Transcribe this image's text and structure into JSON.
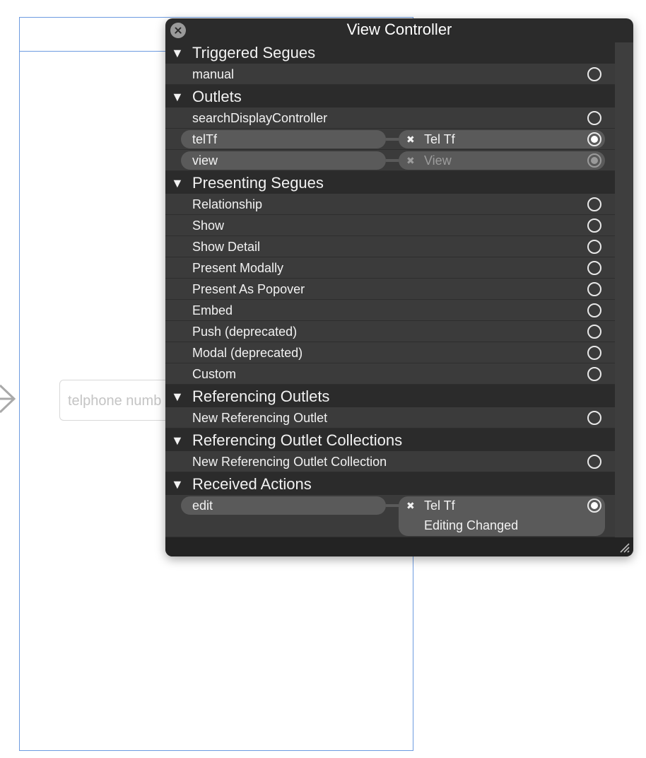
{
  "canvas": {
    "textfield_placeholder": "telphone numb"
  },
  "hud": {
    "title": "View Controller",
    "sections": {
      "triggered_segues": {
        "label": "Triggered Segues",
        "items": [
          {
            "label": "manual"
          }
        ]
      },
      "outlets": {
        "label": "Outlets",
        "items": [
          {
            "label": "searchDisplayController"
          },
          {
            "label": "telTf",
            "target": "Tel Tf"
          },
          {
            "label": "view",
            "target": "View"
          }
        ]
      },
      "presenting_segues": {
        "label": "Presenting Segues",
        "items": [
          {
            "label": "Relationship"
          },
          {
            "label": "Show"
          },
          {
            "label": "Show Detail"
          },
          {
            "label": "Present Modally"
          },
          {
            "label": "Present As Popover"
          },
          {
            "label": "Embed"
          },
          {
            "label": "Push (deprecated)"
          },
          {
            "label": "Modal (deprecated)"
          },
          {
            "label": "Custom"
          }
        ]
      },
      "referencing_outlets": {
        "label": "Referencing Outlets",
        "items": [
          {
            "label": "New Referencing Outlet"
          }
        ]
      },
      "referencing_outlet_collections": {
        "label": "Referencing Outlet Collections",
        "items": [
          {
            "label": "New Referencing Outlet Collection"
          }
        ]
      },
      "received_actions": {
        "label": "Received Actions",
        "items": [
          {
            "label": "edit",
            "target": "Tel Tf",
            "event": "Editing Changed"
          }
        ]
      }
    },
    "disclosure_glyph": "▼",
    "remove_glyph": "✖"
  },
  "colors": {
    "hud_background": "#2b2b2b",
    "row_background": "#3b3b3b",
    "pill_background": "#5a5a5a",
    "canvas_border": "#6d9be0"
  }
}
